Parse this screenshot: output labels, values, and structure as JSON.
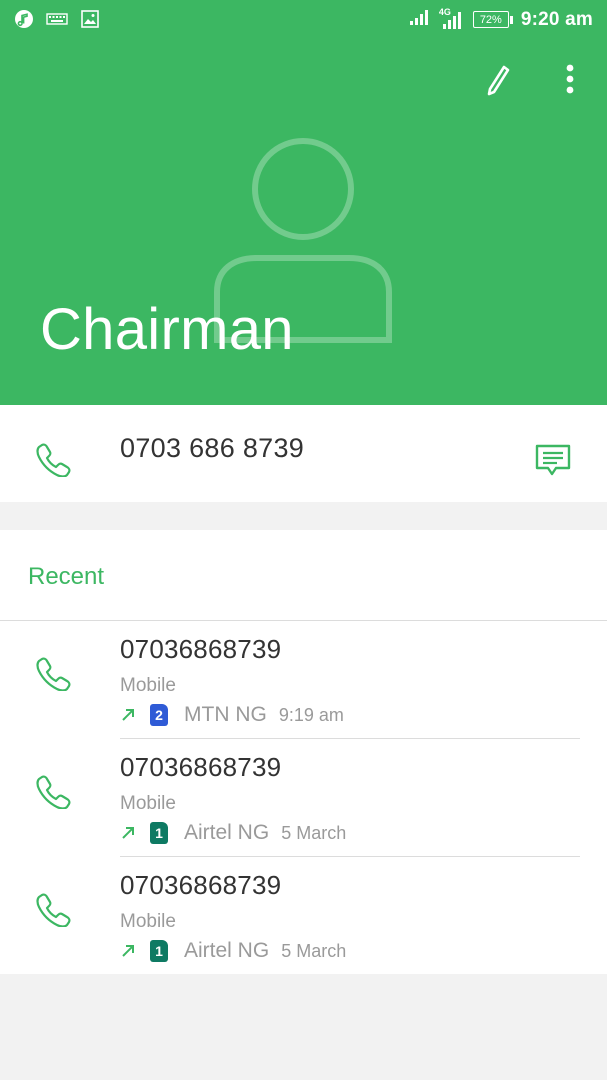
{
  "status_bar": {
    "network": "4G",
    "battery_percent": "72%",
    "time": "9:20 am"
  },
  "contact": {
    "name": "Chairman",
    "phone": "0703 686 8739"
  },
  "recent": {
    "title": "Recent",
    "calls": [
      {
        "number": "07036868739",
        "type": "Mobile",
        "direction": "outgoing",
        "sim": "2",
        "sim_color": "#2f5bd6",
        "carrier": "MTN NG",
        "time": "9:19 am"
      },
      {
        "number": "07036868739",
        "type": "Mobile",
        "direction": "outgoing",
        "sim": "1",
        "sim_color": "#0e7a63",
        "carrier": "Airtel NG",
        "time": "5 March"
      },
      {
        "number": "07036868739",
        "type": "Mobile",
        "direction": "outgoing",
        "sim": "1",
        "sim_color": "#0e7a63",
        "carrier": "Airtel NG",
        "time": "5 March"
      }
    ]
  },
  "colors": {
    "accent": "#3cb762",
    "header_bg": "#3cb762",
    "text_primary": "#333333",
    "text_secondary": "#9a9a9a",
    "page_bg": "#f2f2f2"
  },
  "icons": {
    "status_left": [
      "music-icon",
      "keyboard-icon",
      "image-icon"
    ],
    "status_right": [
      "signal-icon",
      "signal-4g-icon",
      "battery-icon"
    ],
    "toolbar": [
      "edit-pencil-icon",
      "more-vert-icon"
    ],
    "row": [
      "phone-icon",
      "message-icon",
      "outgoing-call-arrow-icon",
      "sim-card-icon"
    ]
  }
}
